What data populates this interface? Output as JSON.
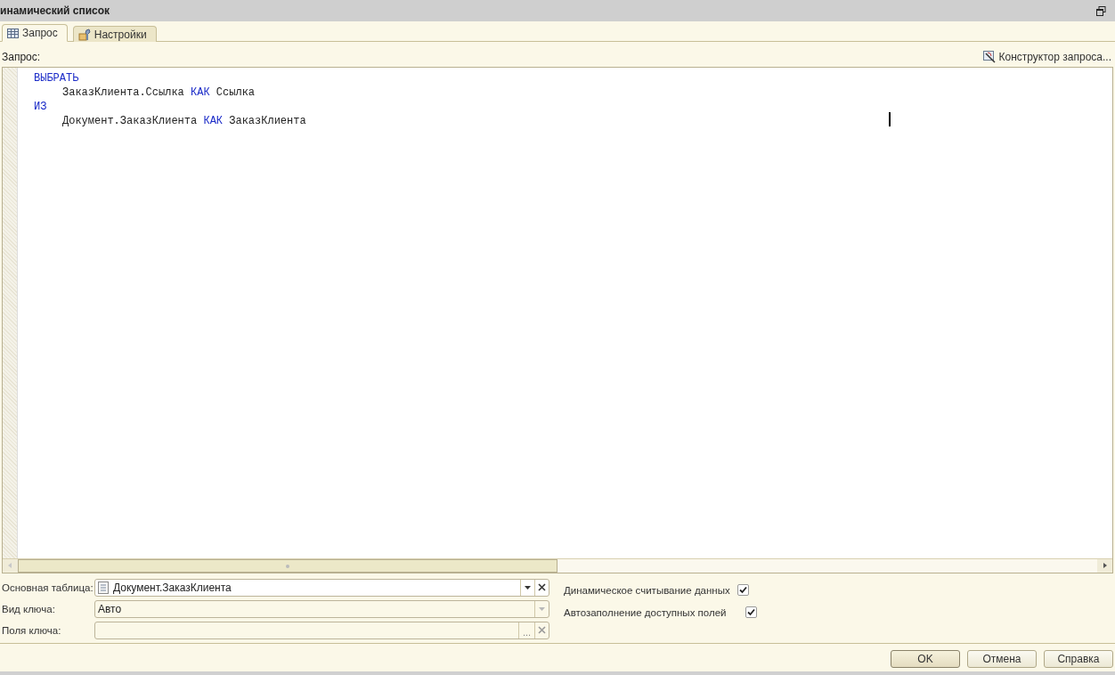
{
  "window": {
    "title": "инамический список"
  },
  "tabs": [
    {
      "label": "Запрос",
      "selected": true,
      "kind": "table"
    },
    {
      "label": "Настройки",
      "selected": false,
      "kind": "settings"
    }
  ],
  "query_label": "Запрос:",
  "constructor_button": "Конструктор запроса...",
  "code_lines": [
    {
      "tokens": [
        {
          "text": "ВЫБРАТЬ",
          "kind": "keyword"
        }
      ],
      "children": [
        {
          "tokens": [
            {
              "text": "ЗаказКлиента.Ссылка ",
              "kind": "plain"
            },
            {
              "text": "КАК",
              "kind": "keyword"
            },
            {
              "text": " Ссылка",
              "kind": "plain"
            }
          ]
        }
      ]
    },
    {
      "tokens": [
        {
          "text": "ИЗ",
          "kind": "keyword"
        }
      ],
      "children": [
        {
          "tokens": [
            {
              "text": "Документ.ЗаказКлиента ",
              "kind": "plain"
            },
            {
              "text": "КАК",
              "kind": "keyword"
            },
            {
              "text": " ЗаказКлиента",
              "kind": "plain"
            }
          ]
        }
      ]
    }
  ],
  "fields": [
    {
      "label": "Основная таблица:",
      "value": "Документ.ЗаказКлиента",
      "kind": "ref",
      "dropdown_enabled": true
    },
    {
      "label": "Вид ключа:",
      "value": "Авто",
      "kind": "plain",
      "dropdown_enabled": false
    },
    {
      "label": "Поля ключа:",
      "kind": "choice",
      "choice_button": "..."
    }
  ],
  "checkboxes": [
    {
      "label": "Динамическое считывание данных",
      "checked": true
    },
    {
      "label": "Автозаполнение доступных полей",
      "checked": true
    }
  ],
  "buttons": [
    {
      "label": "OK",
      "default": true
    },
    {
      "label": "Отмена",
      "default": false
    },
    {
      "label": "Справка",
      "default": false
    }
  ]
}
